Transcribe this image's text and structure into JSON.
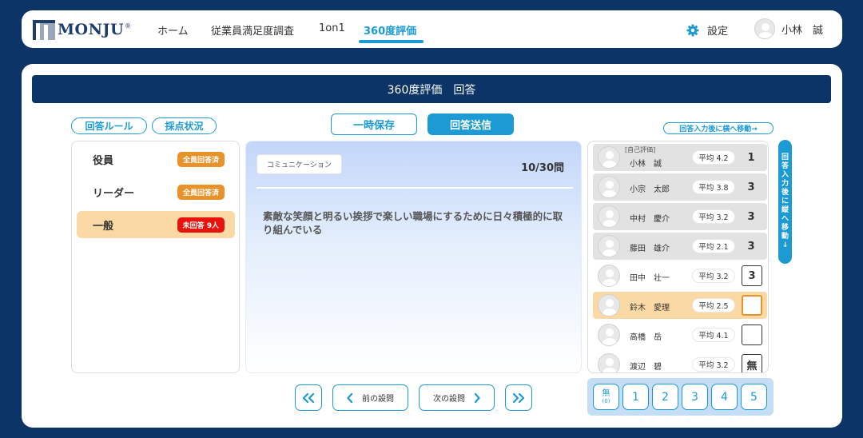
{
  "header": {
    "logo_text": "MONJU",
    "logo_sup": "®",
    "nav": [
      {
        "label": "ホーム"
      },
      {
        "label": "従業員満足度調査"
      },
      {
        "label": "1on1"
      },
      {
        "label": "360度評価"
      }
    ],
    "settings_label": "設定",
    "user_name": "小林　誠"
  },
  "page_title": "360度評価　回答",
  "buttons": {
    "rules": "回答ルール",
    "scoring_status": "採点状況",
    "save_draft": "一時保存",
    "submit": "回答送信",
    "move_horizontal": "回答入力後に横へ移動→",
    "move_vertical": [
      "回",
      "答",
      "入",
      "力",
      "後",
      "に",
      "縦",
      "へ",
      "移",
      "動",
      "↓"
    ]
  },
  "groups": [
    {
      "label": "役員",
      "badge": "全員回答済"
    },
    {
      "label": "リーダー",
      "badge": "全員回答済"
    },
    {
      "label": "一般",
      "badge": "未回答 9人"
    }
  ],
  "question": {
    "category": "コミュニケーション",
    "progress": "10/30問",
    "text": "素敵な笑顔と明るい挨拶で楽しい職場にするために日々積極的に取り組んでいる"
  },
  "pager": {
    "prev_label": "前の設問",
    "next_label": "次の設問"
  },
  "people": [
    {
      "tag": "[自己評価]",
      "name": "小林　誠",
      "avg": "平均  4.2",
      "score": "1"
    },
    {
      "name": "小宗　太郎",
      "avg": "平均  3.8",
      "score": "3"
    },
    {
      "name": "中村　慶介",
      "avg": "平均  3.2",
      "score": "3"
    },
    {
      "name": "藤田　雄介",
      "avg": "平均  2.1",
      "score": "3"
    },
    {
      "name": "田中　壮一",
      "avg": "平均  3.2",
      "score": "3"
    },
    {
      "name": "鈴木　愛理",
      "avg": "平均  2.5",
      "score": ""
    },
    {
      "name": "高橋　岳",
      "avg": "平均  4.1",
      "score": ""
    },
    {
      "name": "渡辺　碧",
      "avg": "平均  3.2",
      "score": "無"
    }
  ],
  "score_pad": {
    "none_label": "無",
    "none_sub": "(0)",
    "values": [
      "1",
      "2",
      "3",
      "4",
      "5"
    ]
  },
  "colors": {
    "navy": "#0d3466",
    "accent": "#1b9ad3",
    "orange": "#e7922a",
    "red": "#e8130e",
    "selected": "#fbd9a4"
  }
}
